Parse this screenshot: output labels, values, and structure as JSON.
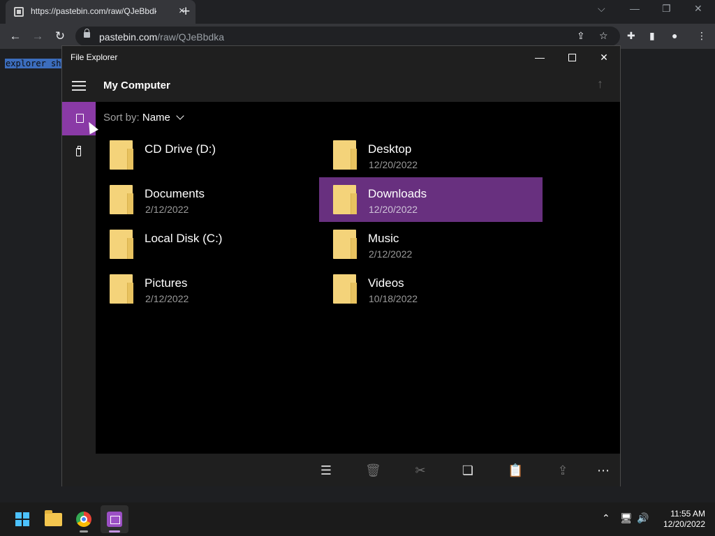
{
  "browser": {
    "tab_title": "https://pastebin.com/raw/QJeBbdka",
    "tab_close": "×",
    "new_tab": "+",
    "url_host": "pastebin.com",
    "url_path": "/raw/QJeBbdka",
    "page_text": "explorer sh"
  },
  "file_explorer": {
    "title": "File Explorer",
    "location": "My Computer",
    "sort_label": "Sort by:",
    "sort_value": "Name",
    "items": [
      {
        "name": "CD Drive (D:)",
        "date": ""
      },
      {
        "name": "Desktop",
        "date": "12/20/2022"
      },
      {
        "name": "Documents",
        "date": "2/12/2022"
      },
      {
        "name": "Downloads",
        "date": "12/20/2022",
        "selected": true
      },
      {
        "name": "Local Disk (C:)",
        "date": ""
      },
      {
        "name": "Music",
        "date": "2/12/2022"
      },
      {
        "name": "Pictures",
        "date": "2/12/2022"
      },
      {
        "name": "Videos",
        "date": "10/18/2022"
      }
    ],
    "selection_color": "#68307f",
    "accent_color": "#8a3aa6"
  },
  "taskbar": {
    "time": "11:55 AM",
    "date": "12/20/2022"
  }
}
